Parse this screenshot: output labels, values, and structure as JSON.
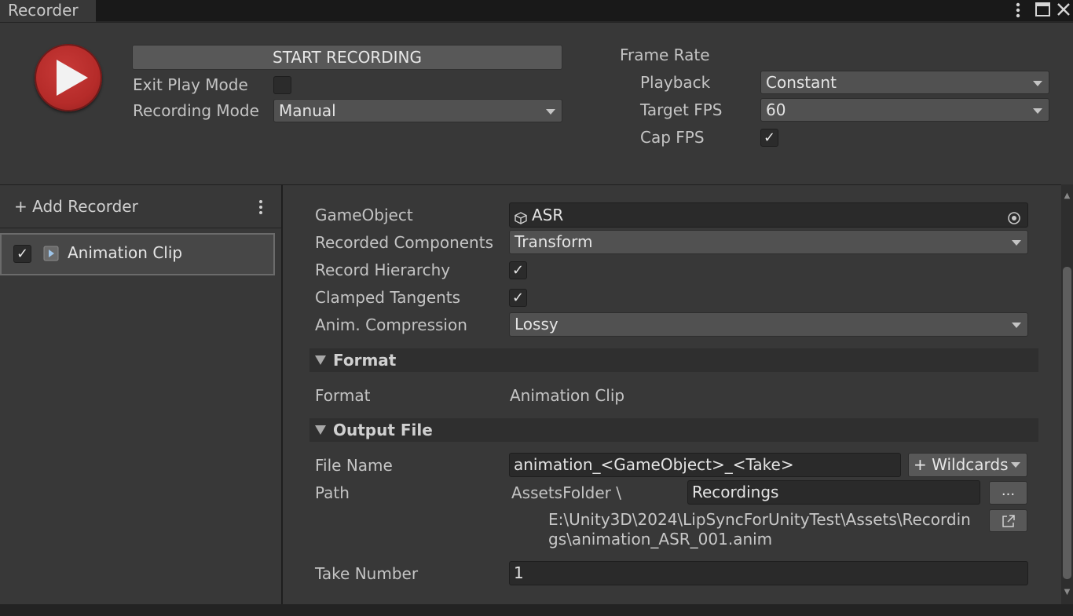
{
  "window": {
    "tab_title": "Recorder",
    "menu_icon": "kebab-menu-icon",
    "maximize_icon": "maximize-icon",
    "close_icon": "close-icon"
  },
  "controls": {
    "play_icon": "record-play-icon",
    "start_recording_label": "START RECORDING",
    "exit_play_mode_label": "Exit Play Mode",
    "exit_play_mode_checked": false,
    "recording_mode_label": "Recording Mode",
    "recording_mode_value": "Manual"
  },
  "frame_rate": {
    "heading": "Frame Rate",
    "playback_label": "Playback",
    "playback_value": "Constant",
    "target_fps_label": "Target FPS",
    "target_fps_value": "60",
    "cap_fps_label": "Cap FPS",
    "cap_fps_checked": true
  },
  "recorder_list": {
    "add_recorder_label": "+ Add Recorder",
    "items": [
      {
        "label": "Animation Clip",
        "enabled": true,
        "icon": "animation-clip-icon"
      }
    ]
  },
  "settings": {
    "gameobject_label": "GameObject",
    "gameobject_value": "ASR",
    "recorded_components_label": "Recorded Components",
    "recorded_components_value": "Transform",
    "record_hierarchy_label": "Record Hierarchy",
    "record_hierarchy_checked": true,
    "clamped_tangents_label": "Clamped Tangents",
    "clamped_tangents_checked": true,
    "anim_compression_label": "Anim. Compression",
    "anim_compression_value": "Lossy"
  },
  "format_section": {
    "header": "Format",
    "format_label": "Format",
    "format_value": "Animation Clip"
  },
  "output_section": {
    "header": "Output File",
    "file_name_label": "File Name",
    "file_name_value": "animation_<GameObject>_<Take>",
    "wildcards_label": "+ Wildcards",
    "path_label": "Path",
    "path_root": "AssetsFolder \\",
    "path_value": "Recordings",
    "browse_label": "...",
    "full_path_line1": "E:\\Unity3D\\2024\\LipSyncForUnityTest\\Assets\\Recordin",
    "full_path_line2": "gs\\animation_ASR_001.anim",
    "take_number_label": "Take Number",
    "take_number_value": "1"
  },
  "colors": {
    "background": "#383838",
    "accent_record": "#b52b29",
    "field": "#515151",
    "input": "#2a2a2a"
  }
}
